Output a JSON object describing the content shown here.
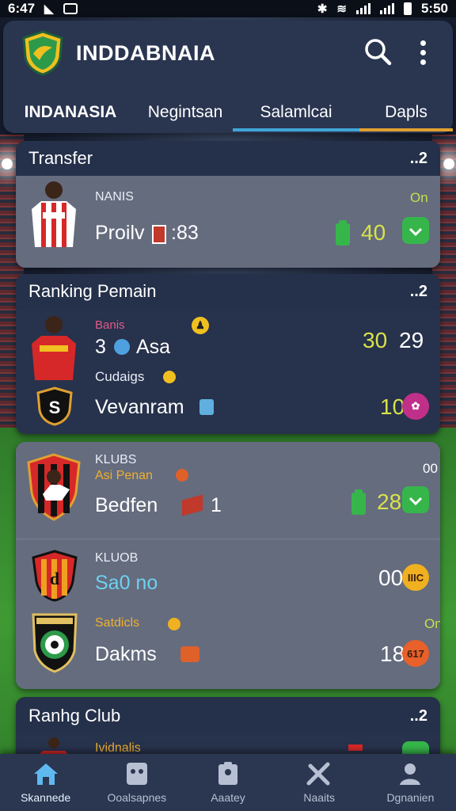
{
  "status_bar": {
    "time_left": "6:47",
    "time_right": "5:50"
  },
  "header": {
    "app_title": "INDDABNAIA",
    "search_icon": "search-icon",
    "menu_icon": "more-vertical-icon"
  },
  "tabs": [
    {
      "label": "INDANASIA",
      "underline": ""
    },
    {
      "label": "Negintsan",
      "underline": ""
    },
    {
      "label": "Salamlcai",
      "underline": "#3fa6d8"
    },
    {
      "label": "Dapls",
      "underline": "#e0a030"
    }
  ],
  "transfer": {
    "title": "Transfer",
    "more": "..2",
    "player_label": "NANIS",
    "detail": "Proilv",
    "detail_num": ":83",
    "status": "On",
    "value": "40"
  },
  "ranking_player": {
    "title": "Ranking Pemain",
    "more": "..2",
    "row1_tag": "Banis",
    "row1_name": "3",
    "row1_name2": "Asa",
    "row1_v1": "30",
    "row1_v2": "29",
    "row2_tag": "Cudaigs",
    "row2_name": "Vevanram",
    "row2_value": "10"
  },
  "club_list": {
    "row1_label": "KLUBS",
    "row1_sub": "Asi Penan",
    "row1_name": "Bedfen",
    "row1_num": "1",
    "row1_status": "00",
    "row1_value": "28",
    "row2_label": "KLUOB",
    "row2_name": "Sa0 no",
    "row2_value": "00",
    "row2_btn": "IIIC",
    "row3_sub": "Satdicls",
    "row3_name": "Dakms",
    "row3_status": "On",
    "row3_value": "18",
    "row3_btn": "617"
  },
  "ranking_club": {
    "title": "Ranhg Club",
    "more": "..2",
    "peek_label": "Ividnalis"
  },
  "bottom_nav": [
    {
      "label": "Skannede",
      "icon": "home-icon"
    },
    {
      "label": "Ooalsapnes",
      "icon": "ghost-icon"
    },
    {
      "label": "Aaatey",
      "icon": "clipboard-icon"
    },
    {
      "label": "Naaits",
      "icon": "tools-icon"
    },
    {
      "label": "Dgnanien",
      "icon": "user-icon"
    }
  ],
  "colors": {
    "accent_green": "#36b64a",
    "accent_lime": "#c6e04a",
    "header_bg": "#2a3550",
    "card_light": "#646c7e",
    "card_dark": "#27324c"
  }
}
